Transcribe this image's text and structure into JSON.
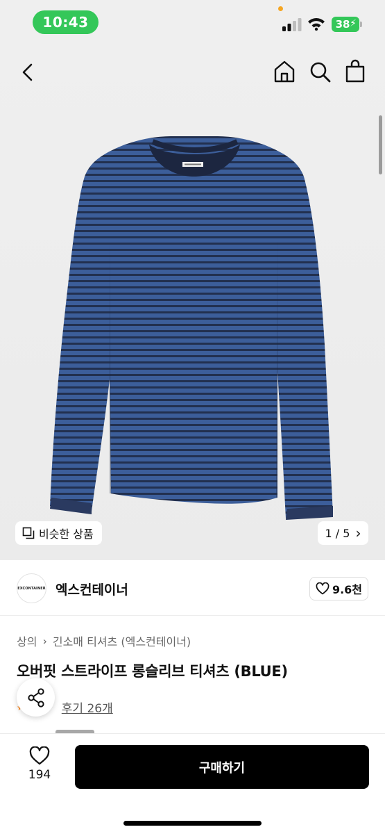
{
  "status_bar": {
    "time": "10:43",
    "battery": "38"
  },
  "colors": {
    "status_green": "#34c759",
    "buy_button": "#000000",
    "shirt_navy": "#25345a",
    "shirt_blue": "#3c5e9a",
    "star_orange": "#ff7a00"
  },
  "nav": {
    "icons": [
      "back-icon",
      "home-icon",
      "search-icon",
      "shopping-bag-icon"
    ]
  },
  "hero": {
    "similar_label": "비슷한 상품",
    "page_indicator": "1 / 5",
    "chevron": "›"
  },
  "brand": {
    "logo_text": "EXCONTAINER",
    "name": "엑스컨테이너",
    "like_count": "9.6천"
  },
  "breadcrumb": {
    "level1": "상의",
    "separator": "›",
    "level2": "긴소매 티셔츠 (엑스컨테이너)"
  },
  "product": {
    "title": "오버핏 스트라이프 롱슬리브 티셔츠 (BLUE)",
    "review_link": "후기 26개"
  },
  "bottom_bar": {
    "wish_count": "194",
    "buy_label": "구매하기"
  }
}
